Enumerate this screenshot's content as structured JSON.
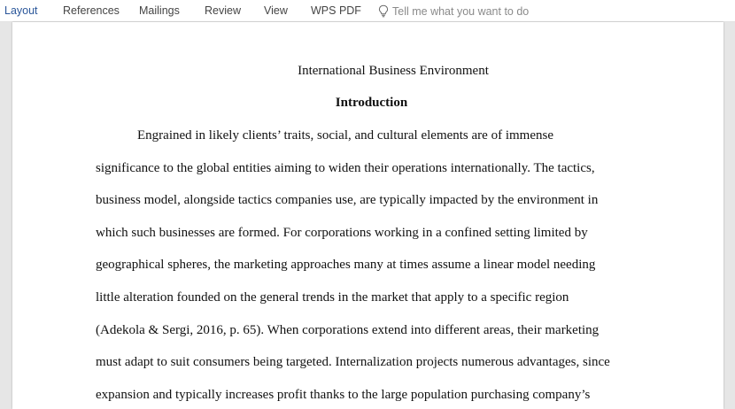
{
  "ribbon": {
    "tabs": [
      {
        "label": "Layout",
        "active": true
      },
      {
        "label": "References"
      },
      {
        "label": "Mailings"
      },
      {
        "label": "Review"
      },
      {
        "label": "View"
      },
      {
        "label": "WPS PDF"
      }
    ],
    "tell_me": {
      "icon": "lightbulb-icon",
      "placeholder": "Tell me what you want to do"
    },
    "accent_color": "#2b579a"
  },
  "document": {
    "title": "International Business Environment",
    "heading": "Introduction",
    "lines": [
      "Engrained in likely clients’ traits, social, and cultural elements are of immense",
      "significance to the global entities aiming to widen their operations internationally. The tactics,",
      "business model, alongside tactics companies use, are typically impacted by the environment in",
      "which such businesses are formed. For corporations working in a confined setting limited by",
      "geographical spheres, the marketing approaches many at times assume a linear model needing",
      "little alteration founded on the general trends in the market that apply to a specific region",
      "(Adekola & Sergi, 2016, p. 65). When corporations extend into different areas, their marketing",
      "must adapt to suit consumers being targeted. Internalization projects numerous advantages, since",
      "expansion and typically increases profit thanks to the large population purchasing company’s"
    ]
  }
}
